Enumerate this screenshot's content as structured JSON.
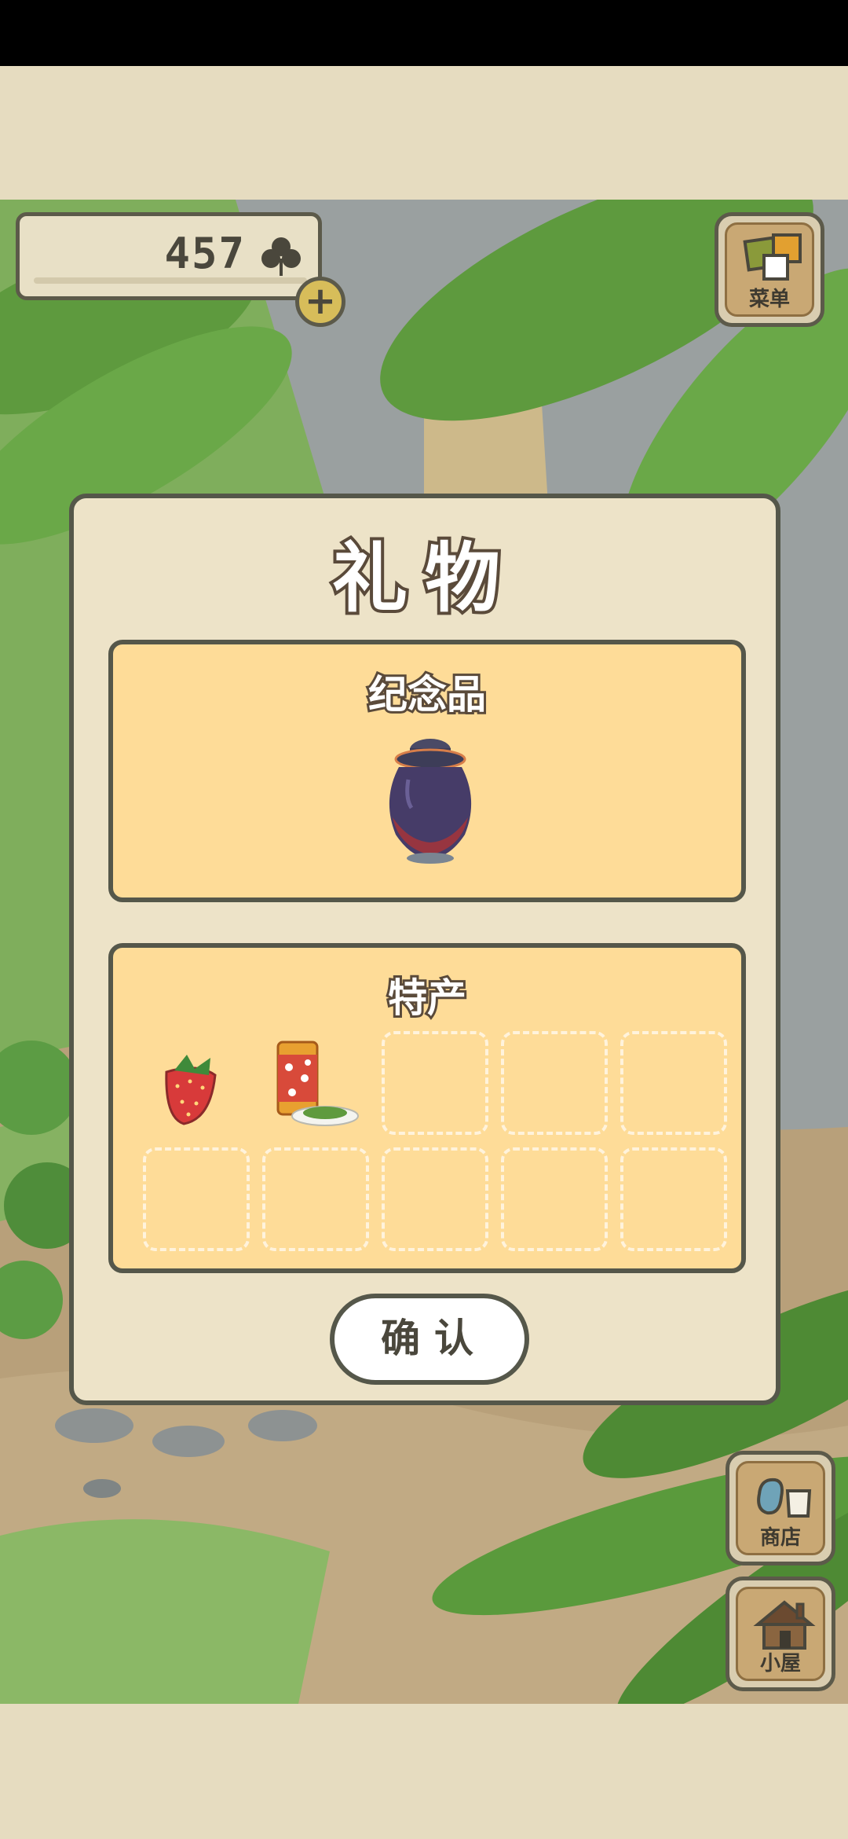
{
  "hud": {
    "clover_count": "457",
    "plus_label": "+",
    "menu_label": "菜单",
    "shop_label": "商店",
    "house_label": "小屋"
  },
  "gift_dialog": {
    "title": "礼物",
    "souvenir_section": {
      "title": "纪念品",
      "item": "clay-jar-icon"
    },
    "specialty_section": {
      "title": "特产",
      "slots": [
        "strawberry-icon",
        "tea-canister-icon",
        "",
        "",
        "",
        "",
        "",
        "",
        "",
        ""
      ]
    },
    "confirm_label": "确认"
  },
  "colors": {
    "panel_fill": "#fedc98",
    "dialog_fill": "#ede3c8",
    "outline": "#55574a"
  }
}
